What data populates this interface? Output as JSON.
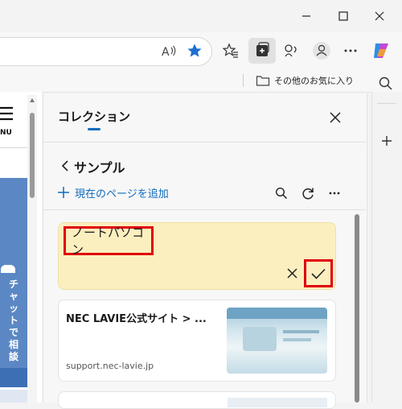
{
  "favorites_bar": {
    "other_favorites_label": "その他のお気に入り"
  },
  "page": {
    "menu_label": "NU",
    "side_banner_chars": [
      "チ",
      "ャ",
      "ッ",
      "ト",
      "で",
      "相",
      "談"
    ]
  },
  "collections_panel": {
    "title": "コレクション",
    "collection_name": "サンプル",
    "add_current_page_label": "現在のページを追加",
    "edit_note_text": "ノートパソコン",
    "items": [
      {
        "title": "NEC LAVIE公式サイト > ...",
        "url": "support.nec-lavie.jp"
      }
    ]
  },
  "colors": {
    "accent": "#0f6cbd",
    "highlight_box": "#e0000b",
    "note_bg": "#fcefbf",
    "favorite_star": "#1f6fd1"
  },
  "icons": [
    "minimize-icon",
    "maximize-icon",
    "read-aloud-icon",
    "favorite-star-icon",
    "favorites-icon",
    "collections-icon",
    "browser-essentials-icon",
    "profile-icon",
    "more-icon",
    "copilot-icon",
    "folder-icon",
    "search-icon",
    "close-icon",
    "back-chevron-icon",
    "plus-icon",
    "refresh-icon",
    "check-icon"
  ]
}
